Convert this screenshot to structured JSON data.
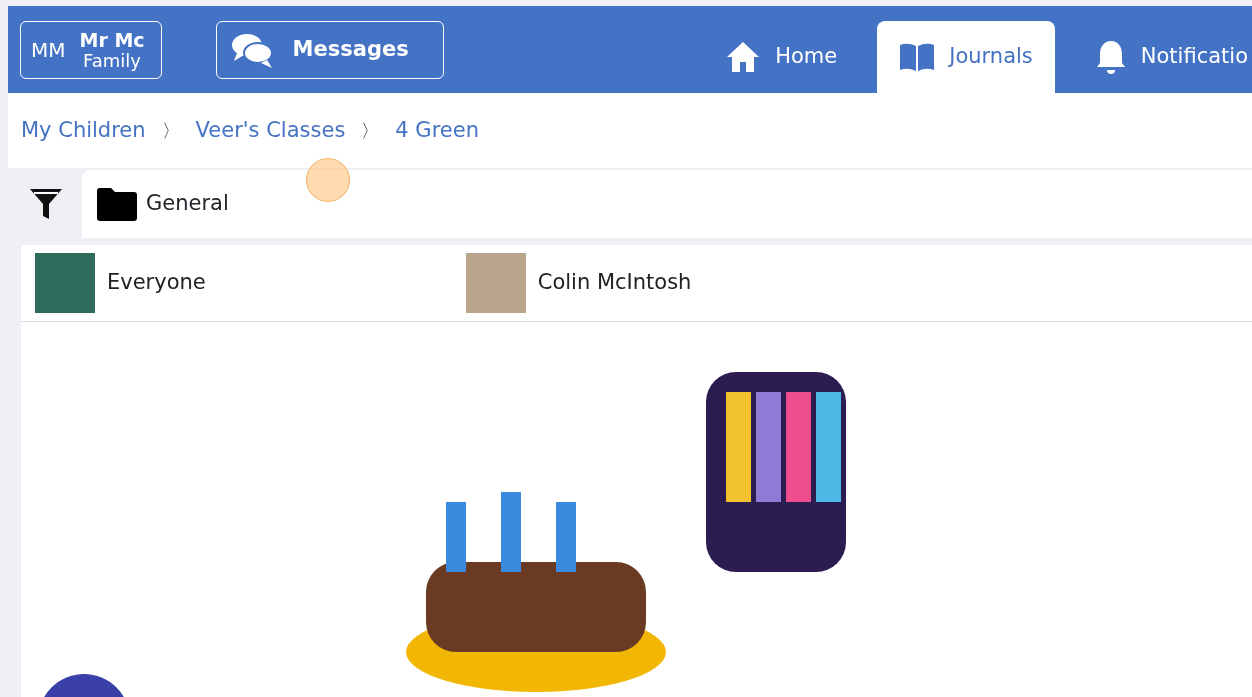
{
  "header": {
    "user_button": {
      "initials": "MM",
      "name_line1": "Mr Mc",
      "name_line2": "Family"
    },
    "messages_button": {
      "label": "Messages"
    },
    "tabs": [
      {
        "label": "Home",
        "kind": "home",
        "selected": false
      },
      {
        "label": "Journals",
        "kind": "journal",
        "selected": true
      },
      {
        "label": "Notificatio",
        "kind": "notifications",
        "selected": false
      }
    ]
  },
  "breadcrumb": {
    "separator": "〉",
    "items": [
      "My Children",
      "Veer's Classes",
      "4 Green"
    ]
  },
  "filter": {
    "folder": "General"
  },
  "post": {
    "audience": "Everyone",
    "author": "Colin McIntosh"
  }
}
